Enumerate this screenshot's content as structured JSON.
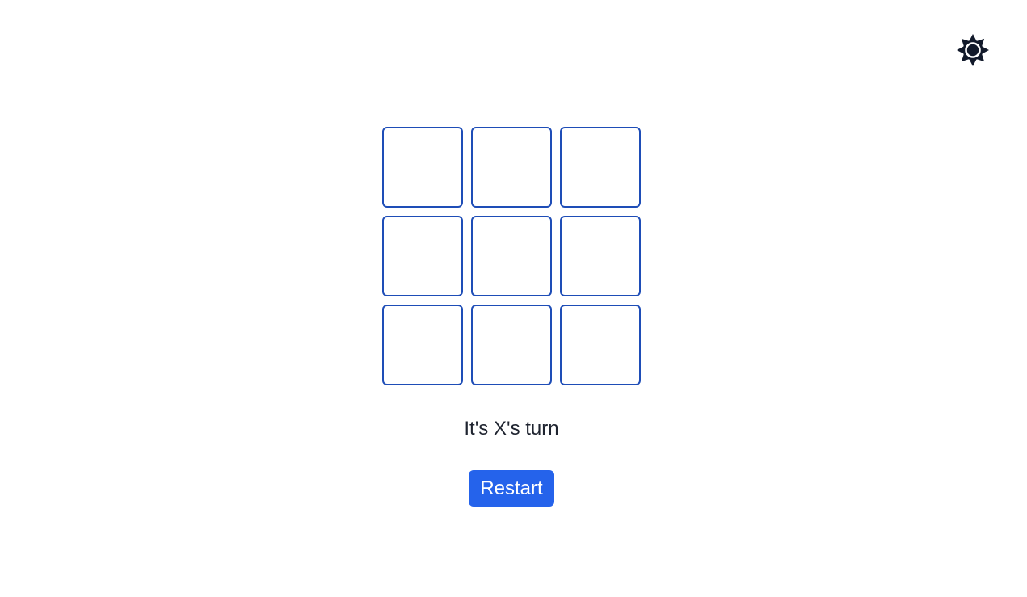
{
  "theme_toggle": {
    "icon": "sun-icon"
  },
  "board": {
    "cells": [
      "",
      "",
      "",
      "",
      "",
      "",
      "",
      "",
      ""
    ]
  },
  "status": {
    "text": "It's X's turn"
  },
  "actions": {
    "restart_label": "Restart"
  },
  "colors": {
    "cell_border": "#1e4db7",
    "button_bg": "#2563eb",
    "icon": "#121a2b",
    "text": "#1f2430"
  }
}
